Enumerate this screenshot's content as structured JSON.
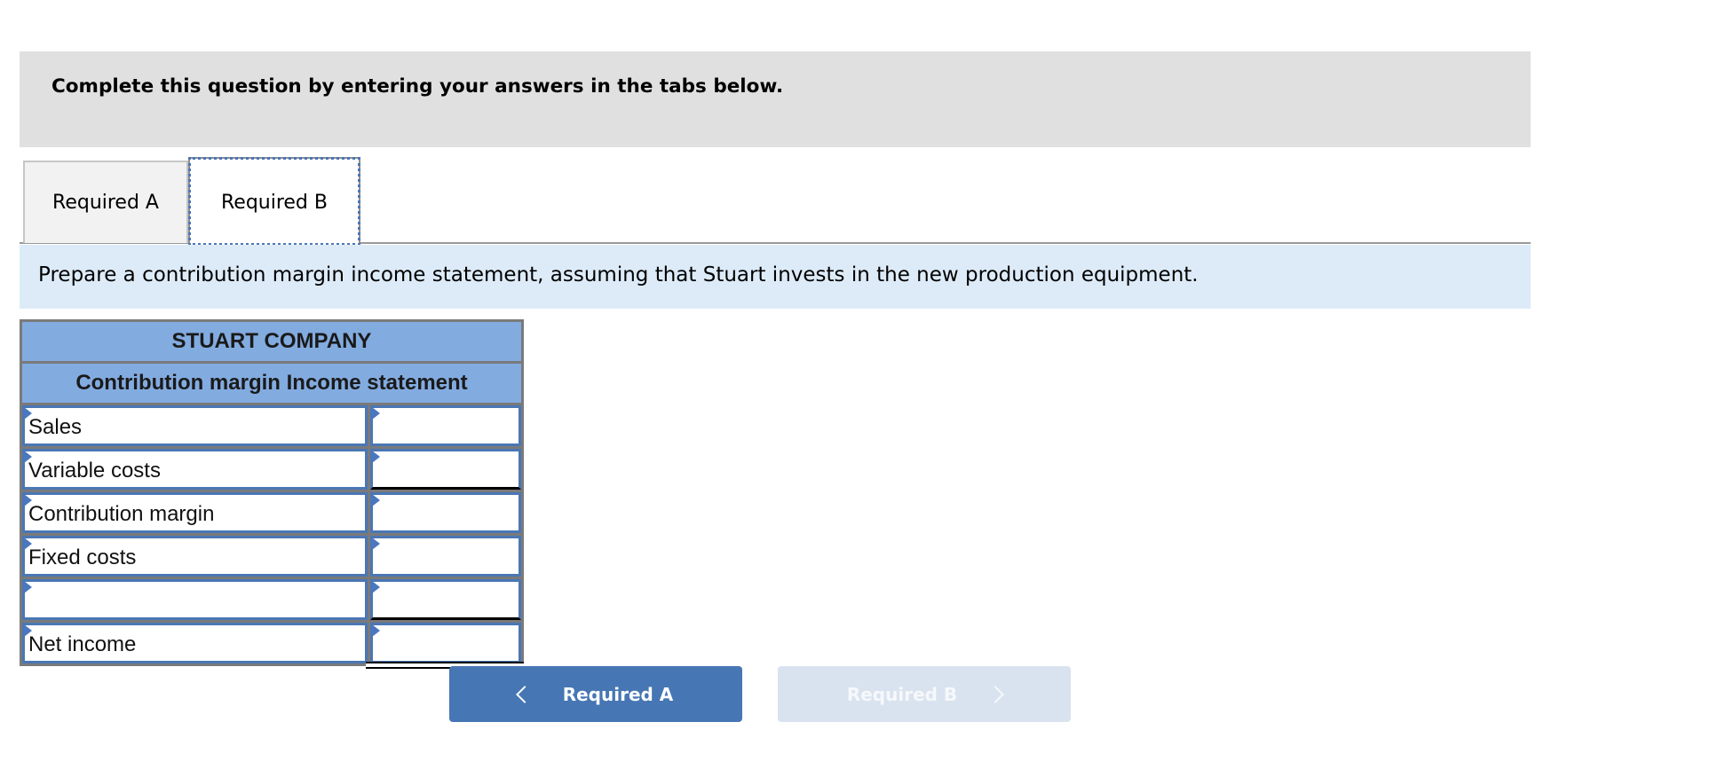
{
  "prompt": {
    "text": "Complete this question by entering your answers in the tabs below."
  },
  "tabs": [
    {
      "label": "Required A",
      "active": false
    },
    {
      "label": "Required B",
      "active": true
    }
  ],
  "instruction": "Prepare a contribution margin income statement, assuming that Stuart invests in the new production equipment.",
  "statement": {
    "company": "STUART COMPANY",
    "title": "Contribution margin Income statement",
    "rows": [
      {
        "label": "Sales",
        "value": ""
      },
      {
        "label": "Variable costs",
        "value": ""
      },
      {
        "label": "Contribution margin",
        "value": ""
      },
      {
        "label": "Fixed costs",
        "value": ""
      },
      {
        "label": "",
        "value": ""
      },
      {
        "label": "Net income",
        "value": ""
      }
    ]
  },
  "navigation": {
    "prev_label": "Required A",
    "next_label": "Required B",
    "next_disabled": true
  },
  "colors": {
    "prompt_bg": "#e0e0e0",
    "instruction_bg": "#ddebf8",
    "header_bg": "#82abe0",
    "cell_border": "#4a77b5",
    "nav_active": "#4676b3",
    "nav_disabled": "#d9e3ef"
  }
}
